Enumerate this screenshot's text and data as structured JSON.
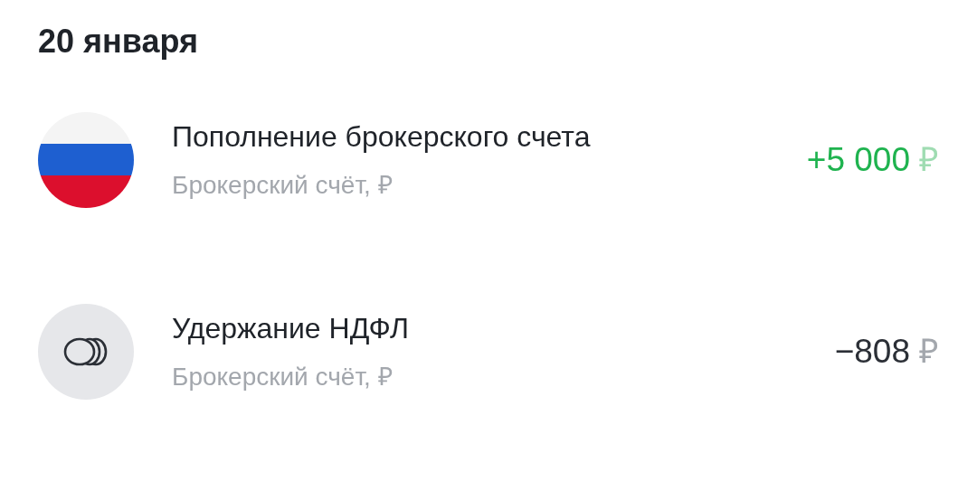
{
  "date_header": "20 января",
  "operations": [
    {
      "kind": "income",
      "title": "Пополнение брокерского счета",
      "account": "Брокерский счёт, ₽",
      "amount": "+5 000",
      "currency": "₽"
    },
    {
      "kind": "expense",
      "title": "Удержание НДФЛ",
      "account": "Брокерский счёт, ₽",
      "amount": "−808",
      "currency": "₽"
    }
  ]
}
